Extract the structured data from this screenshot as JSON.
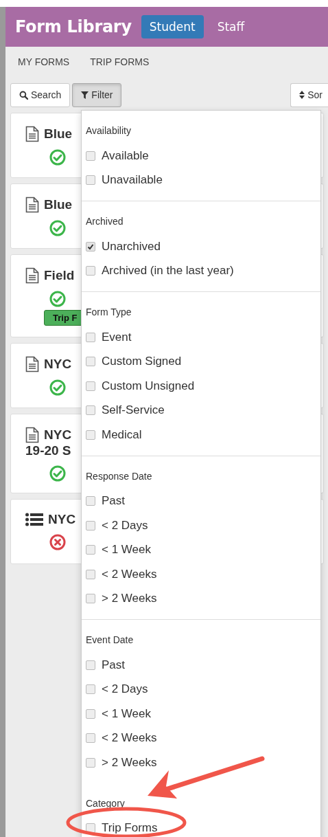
{
  "header": {
    "title": "Form Library",
    "tabs": [
      {
        "label": "Student",
        "selected": true
      },
      {
        "label": "Staff",
        "selected": false
      }
    ]
  },
  "nav": [
    {
      "label": "MY FORMS"
    },
    {
      "label": "TRIP FORMS"
    }
  ],
  "toolbar": {
    "search": "Search",
    "filter": {
      "label": "Filter",
      "pressed": true
    },
    "sort": "Sor"
  },
  "forms": [
    {
      "kind": "document",
      "title_lines": [
        "Blue"
      ],
      "complete": true
    },
    {
      "kind": "document",
      "title_lines": [
        "Blue"
      ],
      "complete": true
    },
    {
      "kind": "document",
      "title_lines": [
        "Field"
      ],
      "complete": true,
      "tag": "Trip F"
    },
    {
      "kind": "document",
      "title_lines": [
        "NYC"
      ],
      "complete": true
    },
    {
      "kind": "document",
      "title_lines": [
        "NYC",
        "19-20 S"
      ],
      "complete": true
    },
    {
      "kind": "list",
      "title_lines": [
        "NYC"
      ],
      "complete": false
    }
  ],
  "filter_menu": [
    {
      "heading": "Availability",
      "divider": true,
      "options": [
        {
          "label": "Available",
          "checked": false
        },
        {
          "label": "Unavailable",
          "checked": false
        }
      ]
    },
    {
      "heading": "Archived",
      "divider": true,
      "options": [
        {
          "label": "Unarchived",
          "checked": true
        },
        {
          "label": "Archived (in the last year)",
          "checked": false
        }
      ]
    },
    {
      "heading": "Form Type",
      "divider": true,
      "options": [
        {
          "label": "Event",
          "checked": false
        },
        {
          "label": "Custom Signed",
          "checked": false
        },
        {
          "label": "Custom Unsigned",
          "checked": false
        },
        {
          "label": "Self-Service",
          "checked": false
        },
        {
          "label": "Medical",
          "checked": false
        }
      ]
    },
    {
      "heading": "Response Date",
      "divider": true,
      "options": [
        {
          "label": "Past",
          "checked": false
        },
        {
          "label": "< 2 Days",
          "checked": false
        },
        {
          "label": "< 1 Week",
          "checked": false
        },
        {
          "label": "< 2 Weeks",
          "checked": false
        },
        {
          "label": "> 2 Weeks",
          "checked": false
        }
      ]
    },
    {
      "heading": "Event Date",
      "divider": false,
      "options": [
        {
          "label": "Past",
          "checked": false
        },
        {
          "label": "< 2 Days",
          "checked": false
        },
        {
          "label": "< 1 Week",
          "checked": false
        },
        {
          "label": "< 2 Weeks",
          "checked": false
        },
        {
          "label": "> 2 Weeks",
          "checked": false
        }
      ]
    },
    {
      "heading": "Category",
      "divider": false,
      "options": [
        {
          "label": "Trip Forms",
          "checked": false
        }
      ]
    }
  ]
}
